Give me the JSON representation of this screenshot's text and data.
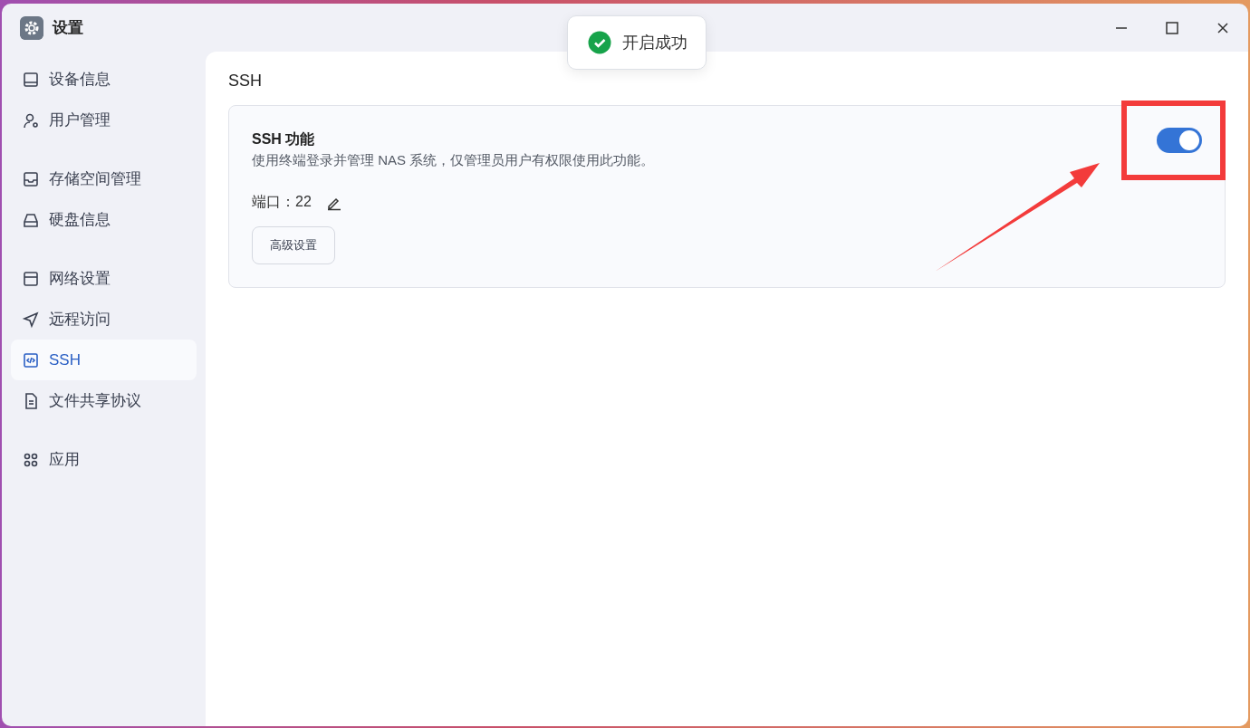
{
  "window": {
    "title": "设置"
  },
  "sidebar": {
    "groups": [
      {
        "items": [
          {
            "label": "设备信息",
            "selected": false
          },
          {
            "label": "用户管理",
            "selected": false
          }
        ]
      },
      {
        "items": [
          {
            "label": "存储空间管理",
            "selected": false
          },
          {
            "label": "硬盘信息",
            "selected": false
          }
        ]
      },
      {
        "items": [
          {
            "label": "网络设置",
            "selected": false
          },
          {
            "label": "远程访问",
            "selected": false
          },
          {
            "label": "SSH",
            "selected": true
          },
          {
            "label": "文件共享协议",
            "selected": false
          }
        ]
      },
      {
        "items": [
          {
            "label": "应用",
            "selected": false
          }
        ]
      }
    ]
  },
  "toast": {
    "text": "开启成功"
  },
  "content": {
    "heading": "SSH",
    "card": {
      "title": "SSH 功能",
      "description": "使用终端登录并管理 NAS 系统，仅管理员用户有权限使用此功能。",
      "port": "端口：22",
      "button": "高级设置",
      "toggle": {
        "on": true
      }
    }
  }
}
